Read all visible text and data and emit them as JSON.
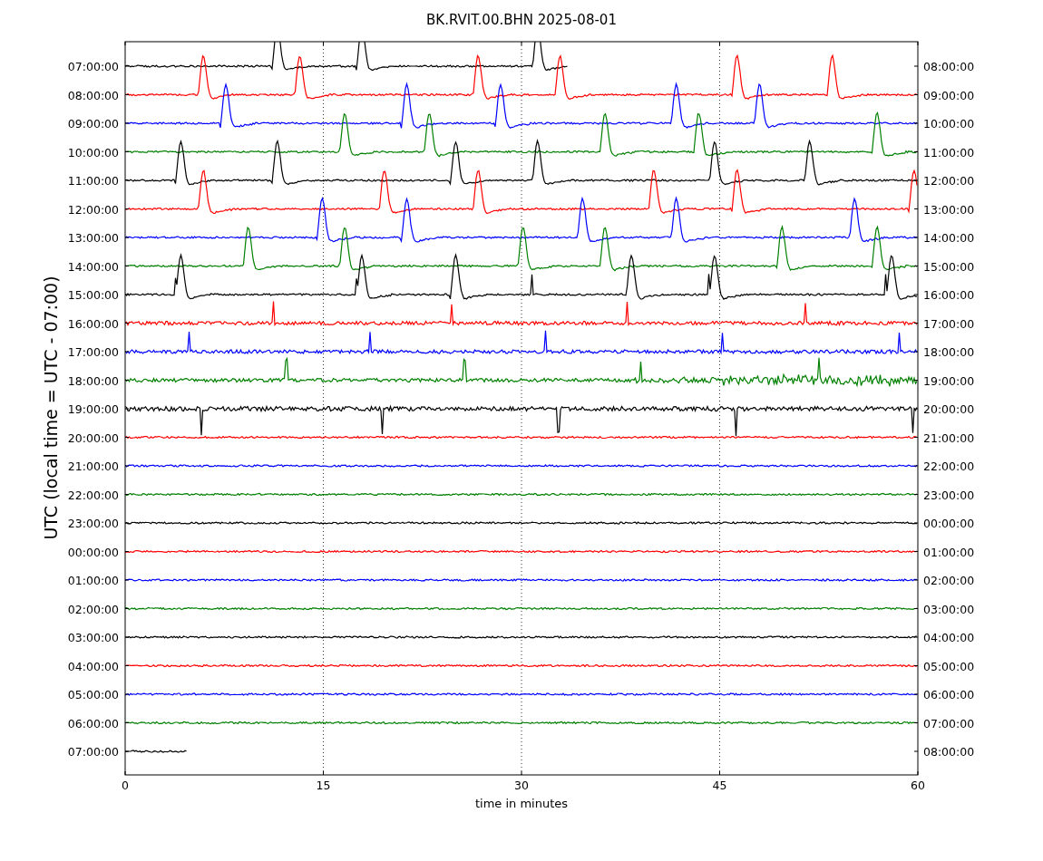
{
  "title": "BK.RVIT.00.BHN 2025-08-01",
  "ylabel": "UTC (local time = UTC - 07:00)",
  "xlabel": "time in minutes",
  "xticks": [
    "0",
    "15",
    "30",
    "45",
    "60"
  ],
  "rows": [
    {
      "left": "07:00:00",
      "right": "08:00:00",
      "color": "#000000"
    },
    {
      "left": "08:00:00",
      "right": "09:00:00",
      "color": "#ff0000"
    },
    {
      "left": "09:00:00",
      "right": "10:00:00",
      "color": "#0000ff"
    },
    {
      "left": "10:00:00",
      "right": "11:00:00",
      "color": "#008000"
    },
    {
      "left": "11:00:00",
      "right": "12:00:00",
      "color": "#000000"
    },
    {
      "left": "12:00:00",
      "right": "13:00:00",
      "color": "#ff0000"
    },
    {
      "left": "13:00:00",
      "right": "14:00:00",
      "color": "#0000ff"
    },
    {
      "left": "14:00:00",
      "right": "15:00:00",
      "color": "#008000"
    },
    {
      "left": "15:00:00",
      "right": "16:00:00",
      "color": "#000000"
    },
    {
      "left": "16:00:00",
      "right": "17:00:00",
      "color": "#ff0000"
    },
    {
      "left": "17:00:00",
      "right": "18:00:00",
      "color": "#0000ff"
    },
    {
      "left": "18:00:00",
      "right": "19:00:00",
      "color": "#008000"
    },
    {
      "left": "19:00:00",
      "right": "20:00:00",
      "color": "#000000"
    },
    {
      "left": "20:00:00",
      "right": "21:00:00",
      "color": "#ff0000"
    },
    {
      "left": "21:00:00",
      "right": "22:00:00",
      "color": "#0000ff"
    },
    {
      "left": "22:00:00",
      "right": "23:00:00",
      "color": "#008000"
    },
    {
      "left": "23:00:00",
      "right": "00:00:00",
      "color": "#000000"
    },
    {
      "left": "00:00:00",
      "right": "01:00:00",
      "color": "#ff0000"
    },
    {
      "left": "01:00:00",
      "right": "02:00:00",
      "color": "#0000ff"
    },
    {
      "left": "02:00:00",
      "right": "03:00:00",
      "color": "#008000"
    },
    {
      "left": "03:00:00",
      "right": "04:00:00",
      "color": "#000000"
    },
    {
      "left": "04:00:00",
      "right": "05:00:00",
      "color": "#ff0000"
    },
    {
      "left": "05:00:00",
      "right": "06:00:00",
      "color": "#0000ff"
    },
    {
      "left": "06:00:00",
      "right": "07:00:00",
      "color": "#008000"
    },
    {
      "left": "07:00:00",
      "right": "08:00:00",
      "color": "#000000"
    }
  ]
}
